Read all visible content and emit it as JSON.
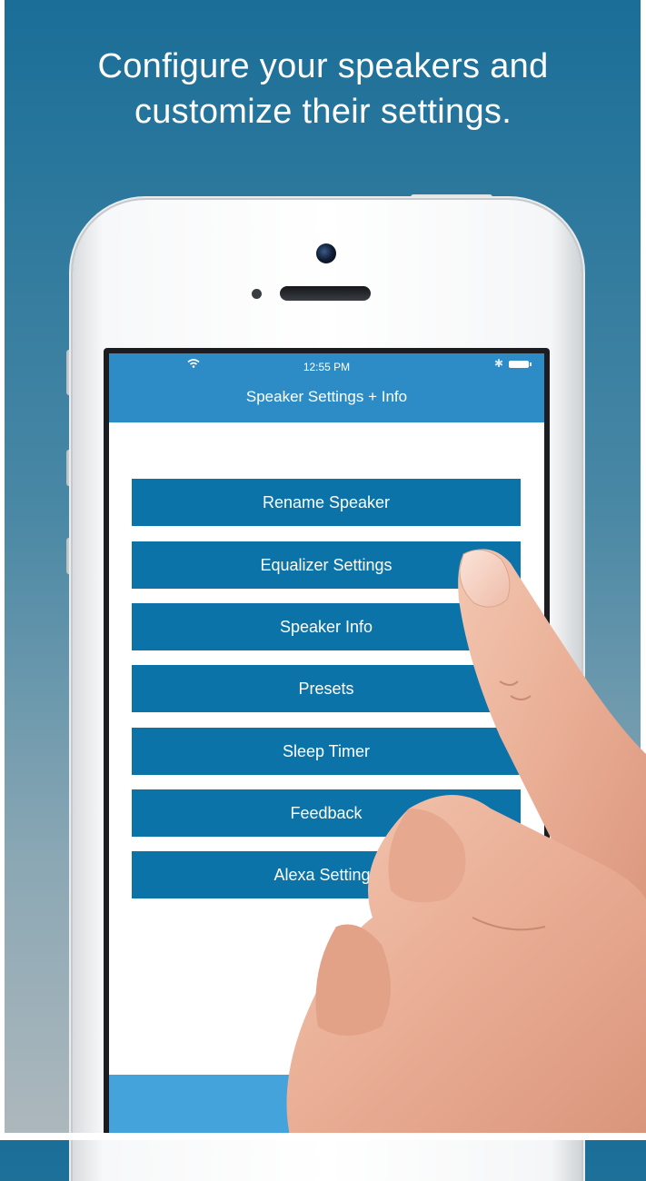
{
  "headline": {
    "line1": "Configure your speakers and",
    "line2": "customize their settings."
  },
  "status_bar": {
    "time": "12:55 PM"
  },
  "nav": {
    "title": "Speaker Settings + Info"
  },
  "menu": {
    "items": [
      {
        "label": "Rename Speaker"
      },
      {
        "label": "Equalizer Settings"
      },
      {
        "label": "Speaker Info"
      },
      {
        "label": "Presets"
      },
      {
        "label": "Sleep Timer"
      },
      {
        "label": "Feedback"
      },
      {
        "label": "Alexa Settings"
      }
    ]
  },
  "colors": {
    "nav_bar": "#2d8cc5",
    "button": "#0b73a7",
    "bottom_bar": "#45a3dc"
  },
  "icons": [
    "wifi-icon",
    "bluetooth-icon",
    "battery-icon"
  ]
}
